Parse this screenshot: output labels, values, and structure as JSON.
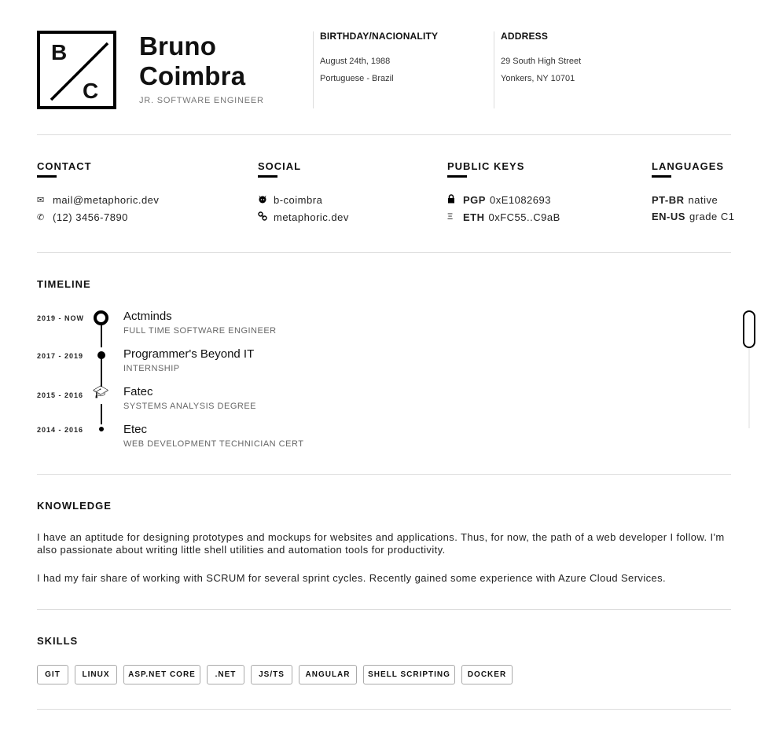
{
  "logo": {
    "letter_top": "B",
    "letter_bottom": "C"
  },
  "header": {
    "first_name": "Bruno",
    "last_name": "Coimbra",
    "role": "JR. SOFTWARE ENGINEER",
    "birthday": {
      "heading": "BIRTHDAY/NACIONALITY",
      "line1": "August 24th, 1988",
      "line2": "Portuguese - Brazil"
    },
    "address": {
      "heading": "ADDRESS",
      "line1": "29 South High Street",
      "line2": "Yonkers, NY 10701"
    }
  },
  "contact": {
    "heading": "CONTACT",
    "email": {
      "icon": "envelope-icon",
      "value": "mail@metaphoric.dev"
    },
    "phone": {
      "icon": "phone-icon",
      "value": "(12) 3456-7890"
    }
  },
  "social": {
    "heading": "SOCIAL",
    "github": {
      "icon": "github-icon",
      "value": "b-coimbra"
    },
    "website": {
      "icon": "link-icon",
      "value": "metaphoric.dev"
    }
  },
  "public_keys": {
    "heading": "PUBLIC KEYS",
    "pgp": {
      "icon": "lock-icon",
      "label": "PGP",
      "value": "0xE1082693"
    },
    "eth": {
      "icon": "ethereum-icon",
      "label": "ETH",
      "value": "0xFC55..C9aB"
    }
  },
  "languages": {
    "heading": "LANGUAGES",
    "items": [
      {
        "code": "PT-BR",
        "level": "native"
      },
      {
        "code": "EN-US",
        "level": "grade C1"
      }
    ]
  },
  "timeline": {
    "heading": "TIMELINE",
    "items": [
      {
        "date": "2019 - NOW",
        "title": "Actminds",
        "subtitle": "FULL TIME SOFTWARE ENGINEER"
      },
      {
        "date": "2017 - 2019",
        "title": "Programmer's Beyond IT",
        "subtitle": "INTERNSHIP"
      },
      {
        "date": "2015 - 2016",
        "title": "Fatec",
        "subtitle": "SYSTEMS ANALYSIS DEGREE",
        "icon": "graduation-cap-icon"
      },
      {
        "date": "2014 - 2016",
        "title": "Etec",
        "subtitle": "WEB DEVELOPMENT TECHNICIAN CERT"
      }
    ]
  },
  "knowledge": {
    "heading": "KNOWLEDGE",
    "paragraphs": [
      "I have an aptitude for designing prototypes and mockups for websites and applications. Thus, for now, the path of a web developer I follow. I'm also passionate about writing little shell utilities and automation tools for productivity.",
      "I had my fair share of working with SCRUM for several sprint cycles. Recently gained some experience with Azure Cloud Services."
    ]
  },
  "skills": {
    "heading": "SKILLS",
    "items": [
      "GIT",
      "LINUX",
      "ASP.NET CORE",
      ".NET",
      "JS/TS",
      "ANGULAR",
      "SHELL SCRIPTING",
      "DOCKER"
    ]
  }
}
